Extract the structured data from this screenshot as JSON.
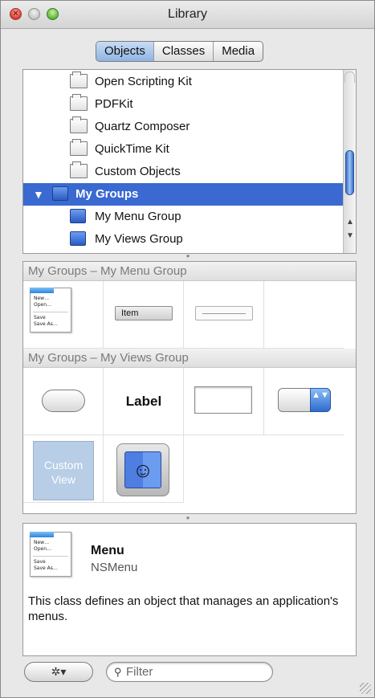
{
  "window": {
    "title": "Library"
  },
  "tabs": [
    {
      "label": "Objects",
      "active": true
    },
    {
      "label": "Classes",
      "active": false
    },
    {
      "label": "Media",
      "active": false
    }
  ],
  "outline": {
    "items": [
      {
        "label": "Open Scripting Kit",
        "icon": "folder-icon"
      },
      {
        "label": "PDFKit",
        "icon": "folder-icon"
      },
      {
        "label": "Quartz Composer",
        "icon": "folder-icon"
      },
      {
        "label": "QuickTime Kit",
        "icon": "folder-icon"
      },
      {
        "label": "Custom Objects",
        "icon": "folder-icon"
      },
      {
        "label": "My Groups",
        "icon": "group-icon",
        "selected": true,
        "expanded": true
      },
      {
        "label": "My Menu Group",
        "icon": "group-icon"
      },
      {
        "label": "My Views Group",
        "icon": "group-icon"
      }
    ],
    "disclosure_glyph": "▼",
    "scroll_up_glyph": "▲",
    "scroll_down_glyph": "▼"
  },
  "groups": [
    {
      "header": "My Groups – My Menu Group",
      "items": [
        {
          "kind": "menu",
          "lines": [
            "New…",
            "Open…",
            "Save",
            "Save As…"
          ]
        },
        {
          "kind": "menu-item",
          "label": "Item"
        },
        {
          "kind": "separator-menu-item"
        }
      ]
    },
    {
      "header": "My Groups – My Views Group",
      "items": [
        {
          "kind": "rounded-button"
        },
        {
          "kind": "label",
          "label": "Label"
        },
        {
          "kind": "text-field"
        },
        {
          "kind": "popup-button",
          "glyph": "▲▼"
        },
        {
          "kind": "custom-view",
          "label": "Custom View"
        },
        {
          "kind": "finder-icon",
          "glyph": "☺"
        }
      ]
    }
  ],
  "info": {
    "title": "Menu",
    "class_name": "NSMenu",
    "thumbnail_lines": [
      "New…",
      "Open…",
      "Save",
      "Save As…"
    ],
    "description": "This class defines an object that manages an application's menus."
  },
  "bottom": {
    "action_glyph": "✲▾",
    "search_placeholder": "Filter",
    "search_value": "",
    "search_glyph": "⚲"
  },
  "colors": {
    "selection": "#3a69d1",
    "segment_active": "#8fb4e2",
    "scroll_thumb": "#3a6cc8"
  }
}
